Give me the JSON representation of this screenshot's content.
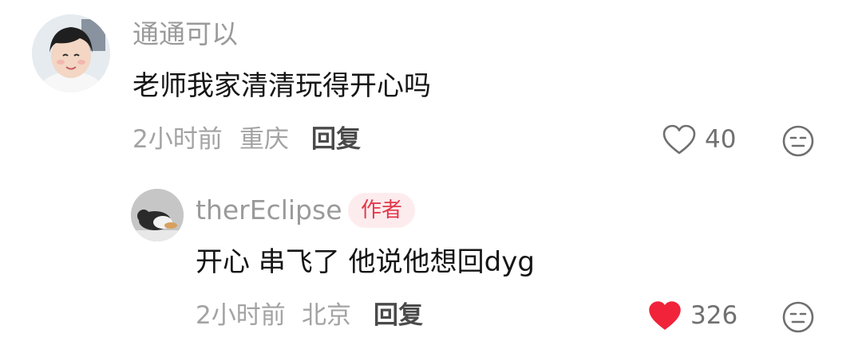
{
  "comments": [
    {
      "username": "通通可以",
      "text": "老师我家清清玩得开心吗",
      "time": "2小时前",
      "location": "重庆",
      "reply_label": "回复",
      "likes": "40",
      "liked": false
    }
  ],
  "reply": {
    "username": "therEclipse",
    "badge": "作者",
    "text": "开心 串飞了 他说他想回dyg",
    "time": "2小时前",
    "location": "北京",
    "reply_label": "回复",
    "likes": "326",
    "liked": true
  },
  "colors": {
    "like_active": "#f0233a",
    "badge_text": "#e23a4a",
    "badge_bg": "#fdecee"
  },
  "icons": {
    "like": "heart-icon",
    "dislike": "dislike-face-icon"
  }
}
